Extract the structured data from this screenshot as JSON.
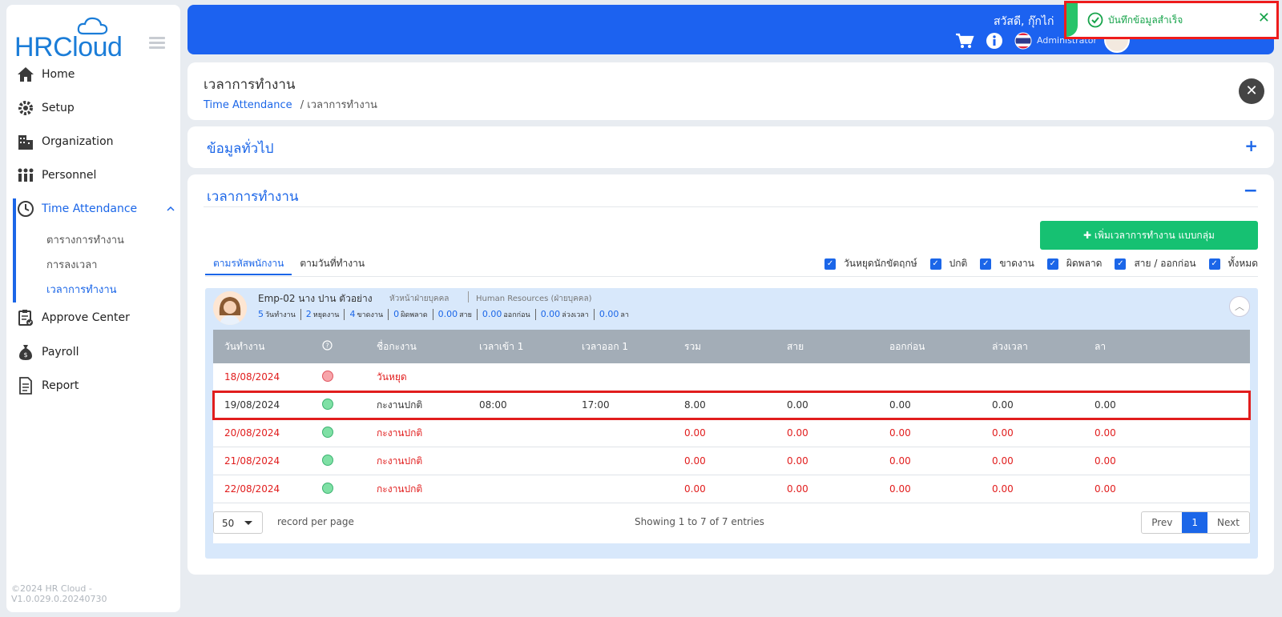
{
  "app": {
    "logo_text": "HRCloud",
    "version": "©2024 HR Cloud -V1.0.029.0.20240730"
  },
  "sidebar": {
    "items": [
      {
        "label": "Home",
        "icon": "home-icon"
      },
      {
        "label": "Setup",
        "icon": "gear-icon"
      },
      {
        "label": "Organization",
        "icon": "building-icon"
      },
      {
        "label": "Personnel",
        "icon": "people-icon"
      },
      {
        "label": "Time Attendance",
        "icon": "clock-icon"
      },
      {
        "label": "Approve Center",
        "icon": "clipboard-check-icon"
      },
      {
        "label": "Payroll",
        "icon": "money-bag-icon"
      },
      {
        "label": "Report",
        "icon": "document-icon"
      }
    ],
    "sub_items": [
      {
        "label": "ตารางการทำงาน"
      },
      {
        "label": "การลงเวลา"
      },
      {
        "label": "เวลาการทำงาน"
      }
    ]
  },
  "header": {
    "greeting": "สวัสดี, กุ๊กไก่",
    "role": "Administrator"
  },
  "toast": {
    "message": "บันทึกข้อมูลสำเร็จ",
    "color": "#16a34a"
  },
  "page": {
    "title": "เวลาการทำงาน",
    "breadcrumb_link": "Time Attendance",
    "breadcrumb_current": "/ เวลาการทำงาน"
  },
  "section_general": {
    "title": "ข้อมูลทั่วไป"
  },
  "section_time": {
    "title": "เวลาการทำงาน",
    "add_button": "✚ เพิ่มเวลาการทำงาน แบบกลุ่ม",
    "tabs": [
      "ตามรหัสพนักงาน",
      "ตามวันที่ทำงาน"
    ],
    "filters": [
      "วันหยุดนักขัตฤกษ์",
      "ปกติ",
      "ขาดงาน",
      "ผิดพลาด",
      "สาย / ออกก่อน",
      "ทั้งหมด"
    ]
  },
  "employee": {
    "name": "Emp-02 นาง ปาน ตัวอย่าง",
    "position": "หัวหน้าฝ่ายบุคคล",
    "department": "Human Resources (ฝ่ายบุคคล)",
    "stats": [
      {
        "num": "5",
        "unit": "วันทำงาน"
      },
      {
        "num": "2",
        "unit": "หยุดงาน"
      },
      {
        "num": "4",
        "unit": "ขาดงาน"
      },
      {
        "num": "0",
        "unit": "ผิดพลาด"
      },
      {
        "num": "0.00",
        "unit": "สาย"
      },
      {
        "num": "0.00",
        "unit": "ออกก่อน"
      },
      {
        "num": "0.00",
        "unit": "ล่วงเวลา"
      },
      {
        "num": "0.00",
        "unit": "ลา"
      }
    ]
  },
  "table": {
    "headers": [
      "วันทำงาน",
      "?",
      "ชื่อกะงาน",
      "เวลาเข้า 1",
      "เวลาออก 1",
      "รวม",
      "สาย",
      "ออกก่อน",
      "ล่วงเวลา",
      "ลา"
    ],
    "rows": [
      {
        "date": "18/08/2024",
        "status": "holiday",
        "shift": "วันหยุด",
        "in": "",
        "out": "",
        "total": "",
        "late": "",
        "early": "",
        "ot": "",
        "leave": ""
      },
      {
        "date": "19/08/2024",
        "status": "normal",
        "shift": "กะงานปกติ",
        "in": "08:00",
        "out": "17:00",
        "total": "8.00",
        "late": "0.00",
        "early": "0.00",
        "ot": "0.00",
        "leave": "0.00"
      },
      {
        "date": "20/08/2024",
        "status": "absent",
        "shift": "กะงานปกติ",
        "in": "",
        "out": "",
        "total": "0.00",
        "late": "0.00",
        "early": "0.00",
        "ot": "0.00",
        "leave": "0.00"
      },
      {
        "date": "21/08/2024",
        "status": "absent",
        "shift": "กะงานปกติ",
        "in": "",
        "out": "",
        "total": "0.00",
        "late": "0.00",
        "early": "0.00",
        "ot": "0.00",
        "leave": "0.00"
      },
      {
        "date": "22/08/2024",
        "status": "absent",
        "shift": "กะงานปกติ",
        "in": "",
        "out": "",
        "total": "0.00",
        "late": "0.00",
        "early": "0.00",
        "ot": "0.00",
        "leave": "0.00"
      }
    ],
    "page_size": "50",
    "rpp_label": "record per page",
    "showing": "Showing 1 to 7 of 7 entries",
    "prev": "Prev",
    "current_page": "1",
    "next": "Next"
  }
}
